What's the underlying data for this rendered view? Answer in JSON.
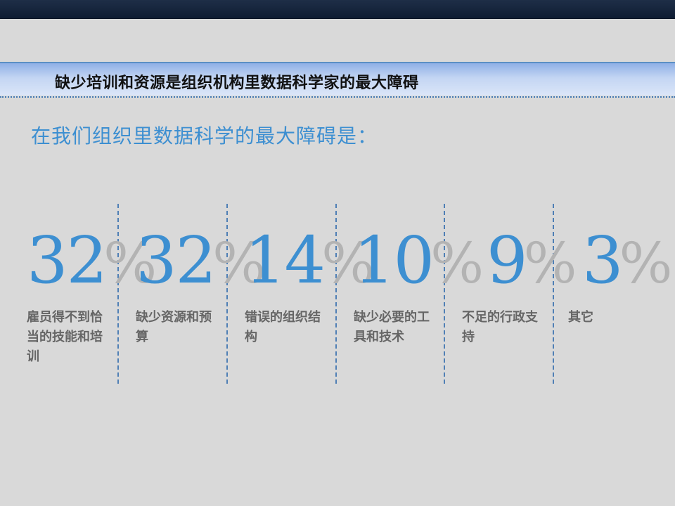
{
  "slide": {
    "title": "缺少培训和资源是组织机构里数据科学家的最大障碍",
    "subtitle": "在我们组织里数据科学的最大障碍是："
  },
  "stats": [
    {
      "value": "32",
      "unit": "%",
      "label": "雇员得不到恰当的技能和培训"
    },
    {
      "value": "32",
      "unit": "%",
      "label": "缺少资源和预算"
    },
    {
      "value": "14",
      "unit": "%",
      "label": "错误的组织结构"
    },
    {
      "value": "10",
      "unit": "%",
      "label": "缺少必要的工具和技术"
    },
    {
      "value": "9",
      "unit": "%",
      "label": "不足的行政支持"
    },
    {
      "value": "3",
      "unit": "%",
      "label": "其它"
    }
  ],
  "colors": {
    "accent": "#3d8fd1",
    "percent": "#b3b3b3",
    "label": "#666666",
    "background": "#d9d9d9",
    "divider": "#4f7fb5"
  }
}
